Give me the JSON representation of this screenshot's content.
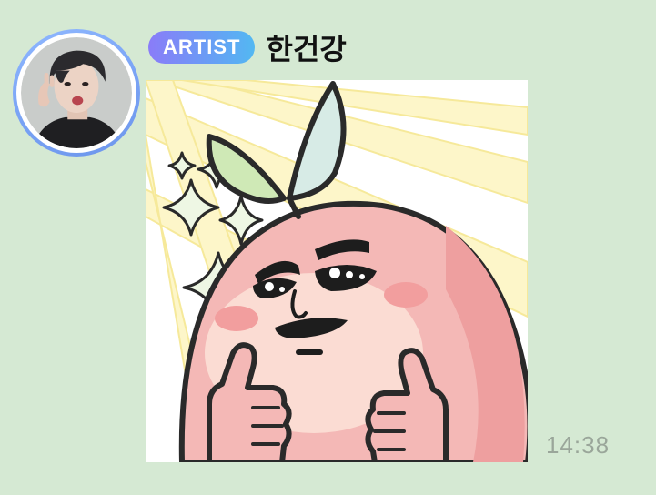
{
  "message": {
    "badge": "ARTIST",
    "sender_name": "한건강",
    "time": "14:38",
    "sticker": "peach-character-thumbs-up-sticker"
  },
  "colors": {
    "chat_background": "#d5e9d3",
    "badge_gradient_start": "#8a7cf8",
    "badge_gradient_end": "#53b8f2",
    "avatar_ring": "#7aa4f5",
    "timestamp": "#9aa69a"
  }
}
